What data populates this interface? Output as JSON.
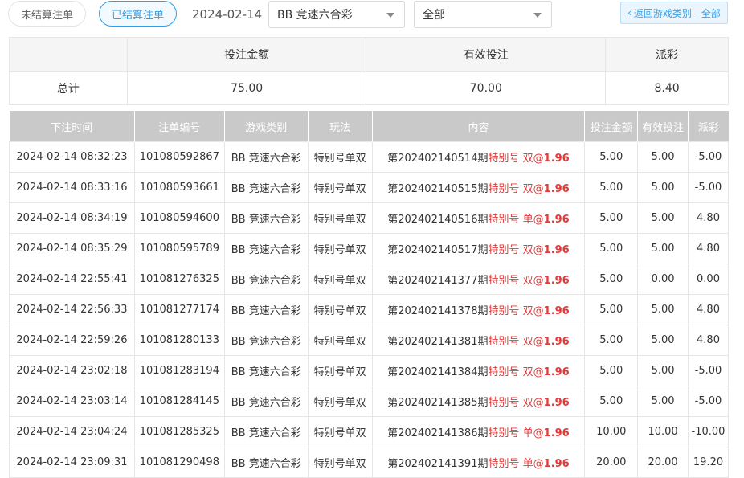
{
  "filters": {
    "unsettled_label": "未结算注单",
    "settled_label": "已结算注单",
    "date": "2024-02-14",
    "game_select": "BB 竞速六合彩",
    "type_select": "全部",
    "back_label": "返回游戏类别 - 全部"
  },
  "summary": {
    "headers": [
      "",
      "投注金额",
      "有效投注",
      "派彩"
    ],
    "total_label": "总计",
    "bet_amount": "75.00",
    "valid_bet": "70.00",
    "payout": "8.40"
  },
  "table": {
    "headers": [
      "下注时间",
      "注单编号",
      "游戏类别",
      "玩法",
      "内容",
      "投注金额",
      "有效投注",
      "派彩"
    ],
    "rows": [
      {
        "time": "2024-02-14 08:32:23",
        "id": "101080592867",
        "game": "BB 竞速六合彩",
        "play": "特别号单双",
        "period": "第202402140514期",
        "pick_label": "特别号",
        "pick": "双",
        "at": "@",
        "odds": "1.96",
        "bet": "5.00",
        "valid": "5.00",
        "payout": "-5.00"
      },
      {
        "time": "2024-02-14 08:33:16",
        "id": "101080593661",
        "game": "BB 竞速六合彩",
        "play": "特别号单双",
        "period": "第202402140515期",
        "pick_label": "特别号",
        "pick": "双",
        "at": "@",
        "odds": "1.96",
        "bet": "5.00",
        "valid": "5.00",
        "payout": "-5.00"
      },
      {
        "time": "2024-02-14 08:34:19",
        "id": "101080594600",
        "game": "BB 竞速六合彩",
        "play": "特别号单双",
        "period": "第202402140516期",
        "pick_label": "特别号",
        "pick": "单",
        "at": "@",
        "odds": "1.96",
        "bet": "5.00",
        "valid": "5.00",
        "payout": "4.80"
      },
      {
        "time": "2024-02-14 08:35:29",
        "id": "101080595789",
        "game": "BB 竞速六合彩",
        "play": "特别号单双",
        "period": "第202402140517期",
        "pick_label": "特别号",
        "pick": "双",
        "at": "@",
        "odds": "1.96",
        "bet": "5.00",
        "valid": "5.00",
        "payout": "4.80"
      },
      {
        "time": "2024-02-14 22:55:41",
        "id": "101081276325",
        "game": "BB 竞速六合彩",
        "play": "特别号单双",
        "period": "第202402141377期",
        "pick_label": "特别号",
        "pick": "双",
        "at": "@",
        "odds": "1.96",
        "bet": "5.00",
        "valid": "0.00",
        "payout": "0.00"
      },
      {
        "time": "2024-02-14 22:56:33",
        "id": "101081277174",
        "game": "BB 竞速六合彩",
        "play": "特别号单双",
        "period": "第202402141378期",
        "pick_label": "特别号",
        "pick": "双",
        "at": "@",
        "odds": "1.96",
        "bet": "5.00",
        "valid": "5.00",
        "payout": "4.80"
      },
      {
        "time": "2024-02-14 22:59:26",
        "id": "101081280133",
        "game": "BB 竞速六合彩",
        "play": "特别号单双",
        "period": "第202402141381期",
        "pick_label": "特别号",
        "pick": "双",
        "at": "@",
        "odds": "1.96",
        "bet": "5.00",
        "valid": "5.00",
        "payout": "4.80"
      },
      {
        "time": "2024-02-14 23:02:18",
        "id": "101081283194",
        "game": "BB 竞速六合彩",
        "play": "特别号单双",
        "period": "第202402141384期",
        "pick_label": "特别号",
        "pick": "双",
        "at": "@",
        "odds": "1.96",
        "bet": "5.00",
        "valid": "5.00",
        "payout": "-5.00"
      },
      {
        "time": "2024-02-14 23:03:14",
        "id": "101081284145",
        "game": "BB 竞速六合彩",
        "play": "特别号单双",
        "period": "第202402141385期",
        "pick_label": "特别号",
        "pick": "双",
        "at": "@",
        "odds": "1.96",
        "bet": "5.00",
        "valid": "5.00",
        "payout": "-5.00"
      },
      {
        "time": "2024-02-14 23:04:24",
        "id": "101081285325",
        "game": "BB 竞速六合彩",
        "play": "特别号单双",
        "period": "第202402141386期",
        "pick_label": "特别号",
        "pick": "单",
        "at": "@",
        "odds": "1.96",
        "bet": "10.00",
        "valid": "10.00",
        "payout": "-10.00"
      },
      {
        "time": "2024-02-14 23:09:31",
        "id": "101081290498",
        "game": "BB 竞速六合彩",
        "play": "特别号单双",
        "period": "第202402141391期",
        "pick_label": "特别号",
        "pick": "单",
        "at": "@",
        "odds": "1.96",
        "bet": "20.00",
        "valid": "20.00",
        "payout": "19.20"
      }
    ]
  },
  "colors": {
    "accent": "#2f9ee8",
    "negative": "#e03a3a",
    "header_bg": "#c9c9c9"
  }
}
